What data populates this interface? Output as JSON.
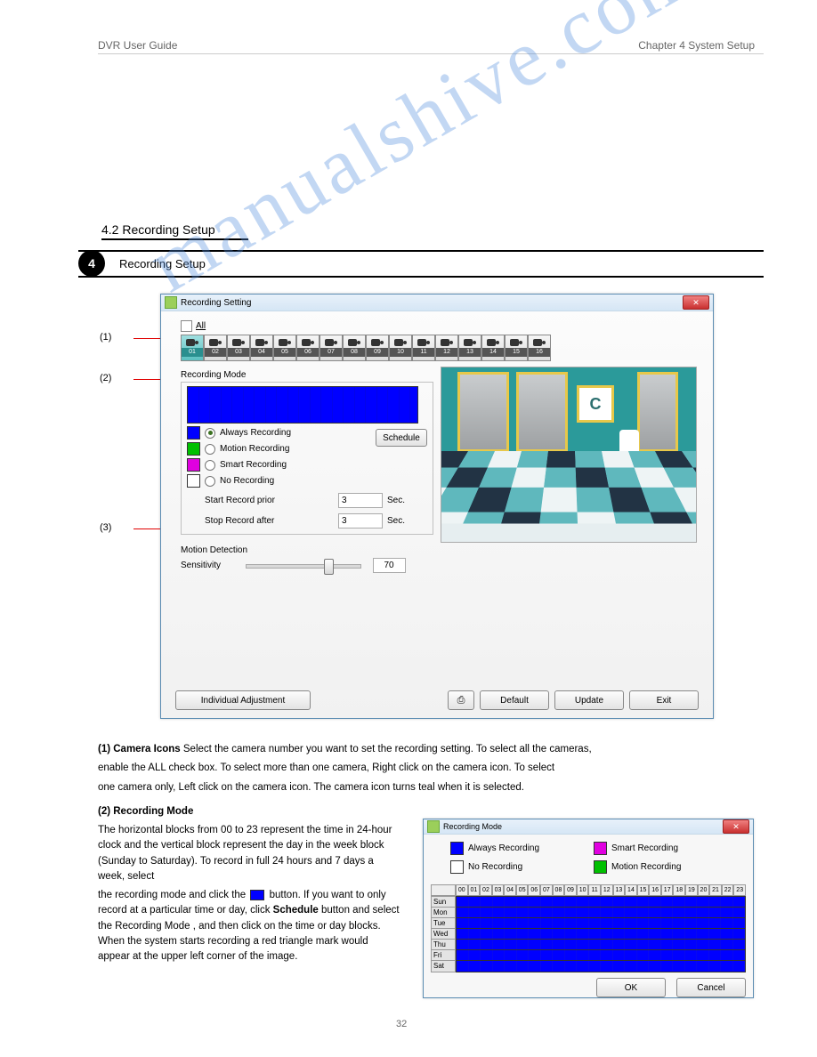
{
  "header": {
    "left": "DVR User Guide",
    "right": "Chapter 4 System Setup",
    "page_number": "32"
  },
  "section": {
    "title": "4.2 Recording Setup"
  },
  "bullet": {
    "number": "4",
    "text": "Recording Setup"
  },
  "annotations": {
    "a1": "(1)",
    "a2": "(2)",
    "a3": "(3)"
  },
  "window": {
    "title": "Recording Setting",
    "all_checkbox_label": "All",
    "cameras": [
      "01",
      "02",
      "03",
      "04",
      "05",
      "06",
      "07",
      "08",
      "09",
      "10",
      "11",
      "12",
      "13",
      "14",
      "15",
      "16"
    ],
    "recording_mode_label": "Recording Mode",
    "legend": {
      "always": "Always Recording",
      "motion": "Motion Recording",
      "smart": "Smart Recording",
      "none": "No Recording"
    },
    "schedule_button": "Schedule",
    "start_prior_label": "Start Record prior",
    "start_prior_value": "3",
    "stop_after_label": "Stop Record after",
    "stop_after_value": "3",
    "sec_suffix": "Sec.",
    "motion_detection_label": "Motion Detection",
    "sensitivity_label": "Sensitivity",
    "sensitivity_value": "70",
    "preview_sign": "C",
    "buttons": {
      "individual": "Individual Adjustment",
      "default": "Default",
      "update": "Update",
      "exit": "Exit"
    }
  },
  "description": {
    "line1_num": "(1) Camera Icons",
    "line1_body": "  Select the camera number you want to set the recording setting. To select all the cameras,",
    "line1b": "enable the ALL check box. To select more than one camera, Right click on the camera icon. To select",
    "line1c": "one camera only, Left click on the camera icon. The camera icon turns teal when it is selected.",
    "line2_num": "(2) Recording Mode",
    "line2_body": "The horizontal blocks from 00 to 23 represent the time in 24-hour clock and the vertical block represent the day in the week block (Sunday to Saturday). To record in full 24 hours and 7 days a week, select",
    "line2b": "the recording mode and click the",
    "line2c": "button. If you want to only record at a particular time or day, click",
    "line2d": "Schedule",
    "line2e": "button and select the Recording Mode , and then click on the time or day blocks. When the system starts recording a red triangle mark would appear at the upper left corner of the image."
  },
  "window2": {
    "title": "Recording Mode",
    "legend": {
      "always": "Always Recording",
      "smart": "Smart Recording",
      "none": "No Recording",
      "motion": "Motion Recording"
    },
    "hours": [
      "00",
      "01",
      "02",
      "03",
      "04",
      "05",
      "06",
      "07",
      "08",
      "09",
      "10",
      "11",
      "12",
      "13",
      "14",
      "15",
      "16",
      "17",
      "18",
      "19",
      "20",
      "21",
      "22",
      "23"
    ],
    "days": [
      "Sun",
      "Mon",
      "Tue",
      "Wed",
      "Thu",
      "Fri",
      "Sat"
    ],
    "ok": "OK",
    "cancel": "Cancel"
  },
  "colors": {
    "always": "#0000ff",
    "motion": "#00c000",
    "smart": "#e000e0",
    "none": "#ffffff"
  },
  "watermark": "manualshive.com"
}
